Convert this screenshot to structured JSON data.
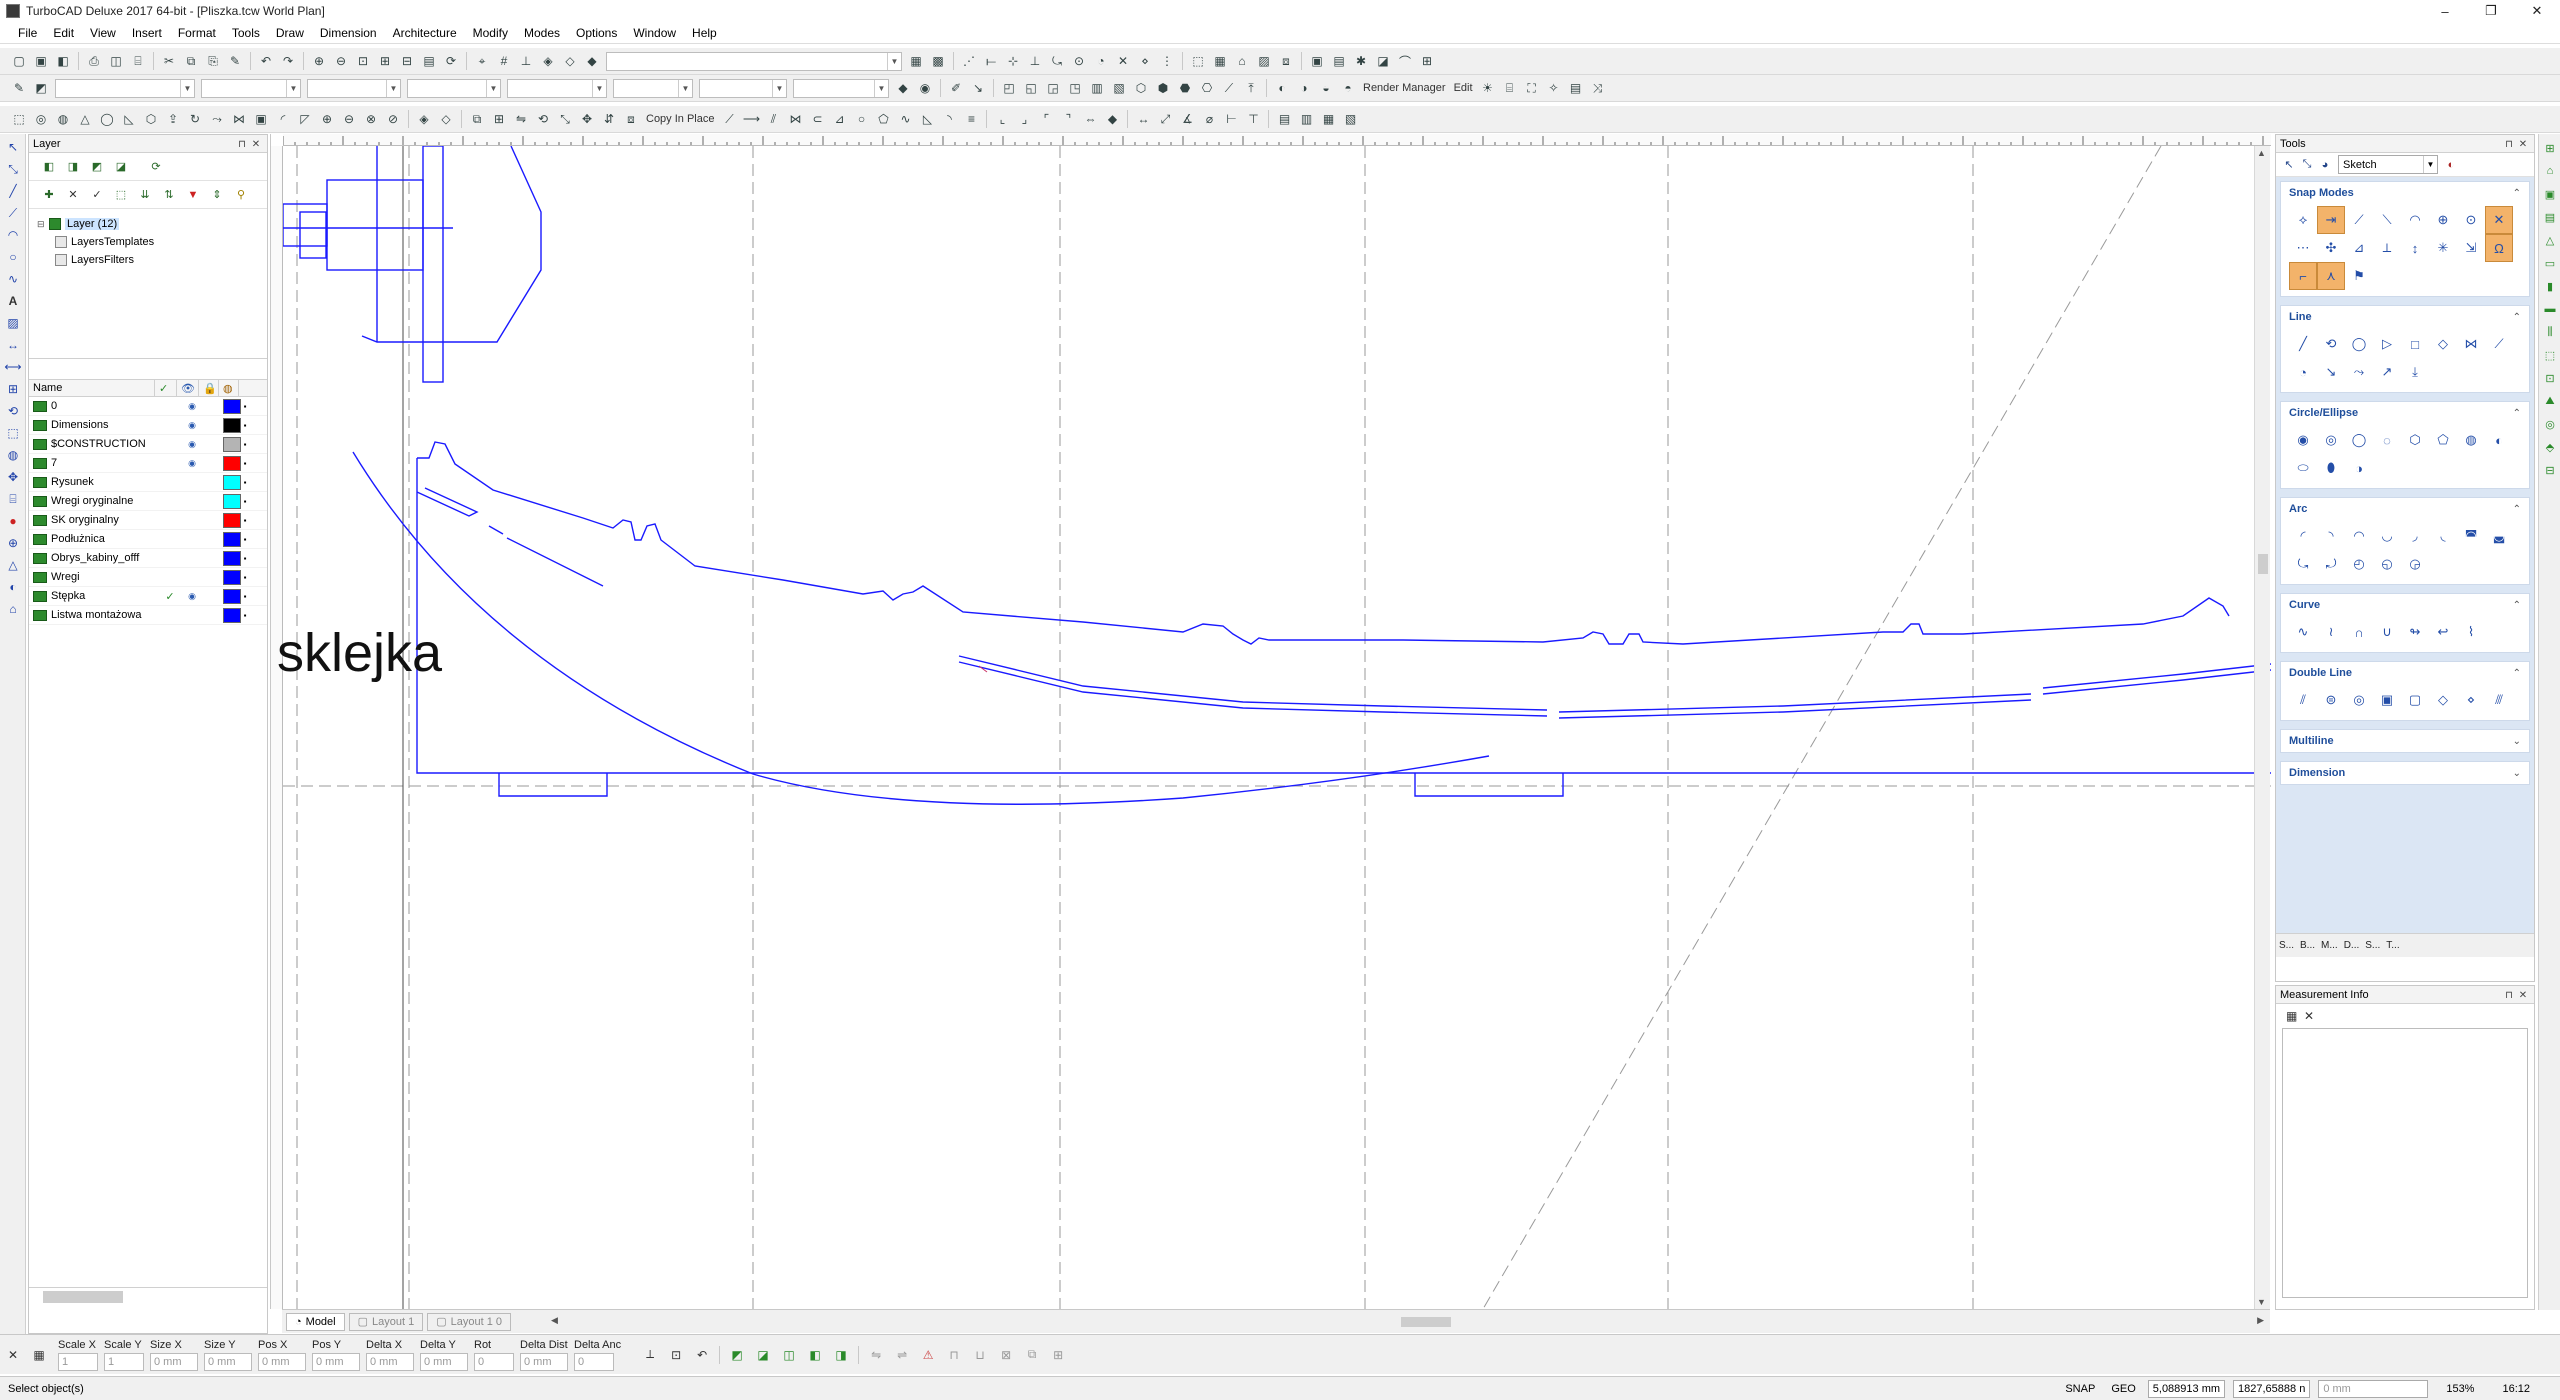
{
  "window": {
    "title": "TurboCAD Deluxe 2017 64-bit - [Pliszka.tcw World Plan]",
    "controls": [
      "–",
      "❐",
      "✕"
    ]
  },
  "menu": [
    "File",
    "Edit",
    "View",
    "Insert",
    "Format",
    "Tools",
    "Draw",
    "Dimension",
    "Architecture",
    "Modify",
    "Modes",
    "Options",
    "Window",
    "Help"
  ],
  "toolbars": {
    "render_manager_label": "Render Manager",
    "edit_label": "Edit",
    "copy_in_place_label": "Copy In Place"
  },
  "layer_panel": {
    "title": "Layer",
    "tree": [
      {
        "label": "Layer (12)",
        "selected": true
      },
      {
        "label": "LayersTemplates",
        "selected": false
      },
      {
        "label": "LayersFilters",
        "selected": false
      }
    ],
    "columns": {
      "name": "Name"
    },
    "layers": [
      {
        "name": "0",
        "active": false,
        "visible": true,
        "color": "#0000ff"
      },
      {
        "name": "Dimensions",
        "active": false,
        "visible": true,
        "color": "#000000"
      },
      {
        "name": "$CONSTRUCTION",
        "active": false,
        "visible": true,
        "color": "#b4b4b4"
      },
      {
        "name": "7",
        "active": false,
        "visible": true,
        "color": "#ff0000"
      },
      {
        "name": "Rysunek",
        "active": false,
        "visible": false,
        "color": "#00ffff"
      },
      {
        "name": "Wregi oryginalne",
        "active": false,
        "visible": false,
        "color": "#00ffff"
      },
      {
        "name": "SK oryginalny",
        "active": false,
        "visible": false,
        "color": "#ff0000"
      },
      {
        "name": "Podłużnica",
        "active": false,
        "visible": false,
        "color": "#0000ff"
      },
      {
        "name": "Obrys_kabiny_offf",
        "active": false,
        "visible": false,
        "color": "#0000ff"
      },
      {
        "name": "Wregi",
        "active": false,
        "visible": false,
        "color": "#0000ff"
      },
      {
        "name": "Stępka",
        "active": true,
        "visible": true,
        "color": "#0000ff"
      },
      {
        "name": "Listwa montażowa",
        "active": false,
        "visible": false,
        "color": "#0000ff"
      }
    ]
  },
  "drawing": {
    "label_text": "sklejka",
    "line_color": "#1a1aff"
  },
  "layout_tabs": [
    {
      "label": "Model",
      "active": true
    },
    {
      "label": "Layout 1",
      "active": false
    },
    {
      "label": "Layout 1 0",
      "active": false
    }
  ],
  "tools_panel": {
    "title": "Tools",
    "mode_value": "Sketch",
    "sections": [
      {
        "title": "Snap Modes",
        "expanded": true,
        "icons": [
          "⟡",
          "⇥",
          "⟋",
          "⟍",
          "◠",
          "⊕",
          "⊙",
          "✕",
          "⋯",
          "✣",
          "⊿",
          "⟂",
          "↕",
          "✳",
          "⇲",
          "Ω",
          "⌐",
          "⋏",
          "⚑"
        ],
        "active": [
          1,
          7,
          15,
          16,
          17
        ]
      },
      {
        "title": "Line",
        "expanded": true,
        "icons": [
          "╱",
          "⟲",
          "◯",
          "▷",
          "□",
          "◇",
          "⋈",
          "⟋",
          "◔",
          "↘",
          "⤳",
          "↗",
          "⤓"
        ],
        "active": []
      },
      {
        "title": "Circle/Ellipse",
        "expanded": true,
        "icons": [
          "◉",
          "◎",
          "◯",
          "◌",
          "⬡",
          "⬠",
          "◍",
          "◐",
          "⬭",
          "⬮",
          "◑"
        ],
        "active": []
      },
      {
        "title": "Arc",
        "expanded": true,
        "icons": [
          "◜",
          "◝",
          "◠",
          "◡",
          "◞",
          "◟",
          "◚",
          "◛",
          "⤿",
          "⤾",
          "◴",
          "◵",
          "◶"
        ],
        "active": []
      },
      {
        "title": "Curve",
        "expanded": true,
        "icons": [
          "∿",
          "≀",
          "∩",
          "∪",
          "↬",
          "↩",
          "⌇"
        ],
        "active": []
      },
      {
        "title": "Double Line",
        "expanded": true,
        "icons": [
          "⫽",
          "⊜",
          "◎",
          "▣",
          "▢",
          "◇",
          "⋄",
          "⫻"
        ],
        "active": []
      },
      {
        "title": "Multiline",
        "expanded": false,
        "icons": [],
        "active": []
      },
      {
        "title": "Dimension",
        "expanded": false,
        "icons": [],
        "active": []
      }
    ],
    "bottom_tabs": [
      "S...",
      "B...",
      "M...",
      "D...",
      "S...",
      "T..."
    ]
  },
  "measure_panel": {
    "title": "Measurement Info"
  },
  "inspector": {
    "fields": [
      {
        "label": "Scale X",
        "value": "1"
      },
      {
        "label": "Scale Y",
        "value": "1"
      },
      {
        "label": "Size X",
        "value": "0 mm"
      },
      {
        "label": "Size Y",
        "value": "0 mm"
      },
      {
        "label": "Pos X",
        "value": "0 mm"
      },
      {
        "label": "Pos Y",
        "value": "0 mm"
      },
      {
        "label": "Delta X",
        "value": "0 mm"
      },
      {
        "label": "Delta Y",
        "value": "0 mm"
      },
      {
        "label": "Rot",
        "value": "0"
      },
      {
        "label": "Delta Dist",
        "value": "0 mm"
      },
      {
        "label": "Delta Anc",
        "value": "0"
      }
    ]
  },
  "status": {
    "message": "Select object(s)",
    "snap": "SNAP",
    "geo": "GEO",
    "x_coord": "5,088913 mm",
    "y_coord": "1827,65888 n",
    "z_coord": "0 mm",
    "zoom": "153%",
    "time": "16:12"
  }
}
